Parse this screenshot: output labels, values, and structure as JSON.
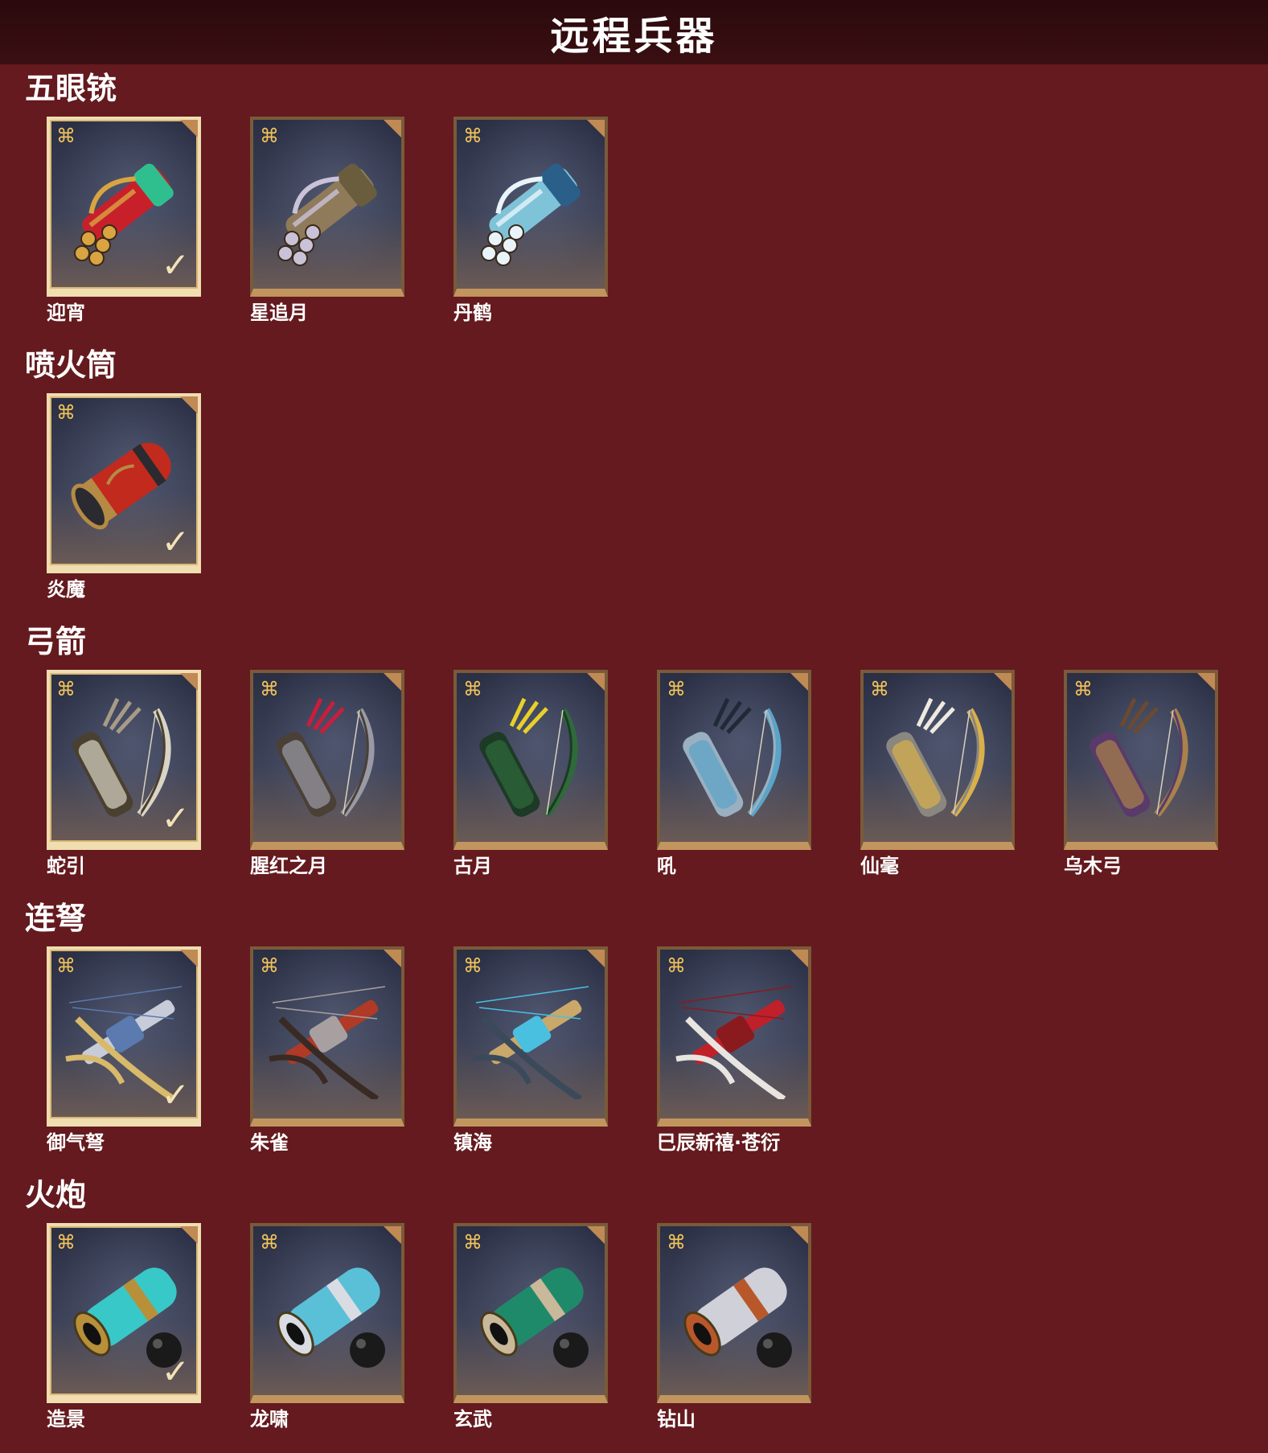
{
  "header": {
    "title": "远程兵器"
  },
  "sections": [
    {
      "title": "五眼铳",
      "items": [
        {
          "name": "迎宵",
          "selected": true,
          "icon": "five-barrel-gun-icon",
          "colors": [
            "#c8202a",
            "#d9a441",
            "#2fbf8f"
          ]
        },
        {
          "name": "星追月",
          "selected": false,
          "icon": "five-barrel-gun-icon",
          "colors": [
            "#8f7a5a",
            "#c9c2d8",
            "#6a5d3d"
          ]
        },
        {
          "name": "丹鹤",
          "selected": false,
          "icon": "five-barrel-gun-icon",
          "colors": [
            "#7ec3d8",
            "#e9f4fa",
            "#2a5f8a"
          ]
        }
      ]
    },
    {
      "title": "喷火筒",
      "items": [
        {
          "name": "炎魔",
          "selected": true,
          "icon": "fire-tube-icon",
          "colors": [
            "#c22a1e",
            "#b58a45",
            "#2a2a30"
          ]
        }
      ]
    },
    {
      "title": "弓箭",
      "items": [
        {
          "name": "蛇引",
          "selected": true,
          "icon": "bow-and-quiver-icon",
          "colors": [
            "#a89b86",
            "#d9d4c6",
            "#4a4030"
          ]
        },
        {
          "name": "腥红之月",
          "selected": false,
          "icon": "bow-and-quiver-icon",
          "colors": [
            "#c81e3c",
            "#9a9aa6",
            "#4a4036"
          ]
        },
        {
          "name": "古月",
          "selected": false,
          "icon": "bow-and-quiver-icon",
          "colors": [
            "#e8d02a",
            "#2f6a3a",
            "#1c3a26"
          ]
        },
        {
          "name": "吼",
          "selected": false,
          "icon": "bow-and-quiver-icon",
          "colors": [
            "#1f2a36",
            "#5aa4c8",
            "#9ab0c0"
          ]
        },
        {
          "name": "仙毫",
          "selected": false,
          "icon": "bow-and-quiver-icon",
          "colors": [
            "#eeeae0",
            "#d9b04a",
            "#8a8680"
          ]
        },
        {
          "name": "乌木弓",
          "selected": false,
          "icon": "bow-and-quiver-icon",
          "colors": [
            "#6a4a30",
            "#a8824a",
            "#5a3a6a"
          ]
        }
      ]
    },
    {
      "title": "连弩",
      "items": [
        {
          "name": "御气弩",
          "selected": true,
          "icon": "repeating-crossbow-icon",
          "colors": [
            "#c8ccd8",
            "#d9b96a",
            "#5a7ab0"
          ]
        },
        {
          "name": "朱雀",
          "selected": false,
          "icon": "repeating-crossbow-icon",
          "colors": [
            "#b03a26",
            "#3a2a24",
            "#a8a0a0"
          ]
        },
        {
          "name": "镇海",
          "selected": false,
          "icon": "repeating-crossbow-icon",
          "colors": [
            "#c9a86a",
            "#3a4a5a",
            "#4ac0e0"
          ]
        },
        {
          "name": "巳辰新禧·苍衍",
          "selected": false,
          "icon": "repeating-crossbow-icon",
          "colors": [
            "#c0202a",
            "#e8e4e0",
            "#8a1a1e"
          ]
        }
      ]
    },
    {
      "title": "火炮",
      "items": [
        {
          "name": "造景",
          "selected": true,
          "icon": "cannon-icon",
          "colors": [
            "#38c8c8",
            "#b8903a",
            "#1a1a1a"
          ]
        },
        {
          "name": "龙啸",
          "selected": false,
          "icon": "cannon-icon",
          "colors": [
            "#5ac0d8",
            "#d9dce2",
            "#1a1a1a"
          ]
        },
        {
          "name": "玄武",
          "selected": false,
          "icon": "cannon-icon",
          "colors": [
            "#1f8a6a",
            "#c9b89a",
            "#1a1a1a"
          ]
        },
        {
          "name": "钻山",
          "selected": false,
          "icon": "cannon-icon",
          "colors": [
            "#d0d0d8",
            "#b8582a",
            "#1a1a1a"
          ]
        }
      ]
    }
  ],
  "ui": {
    "quality_icon": "⌘",
    "check_icon": "✓"
  }
}
